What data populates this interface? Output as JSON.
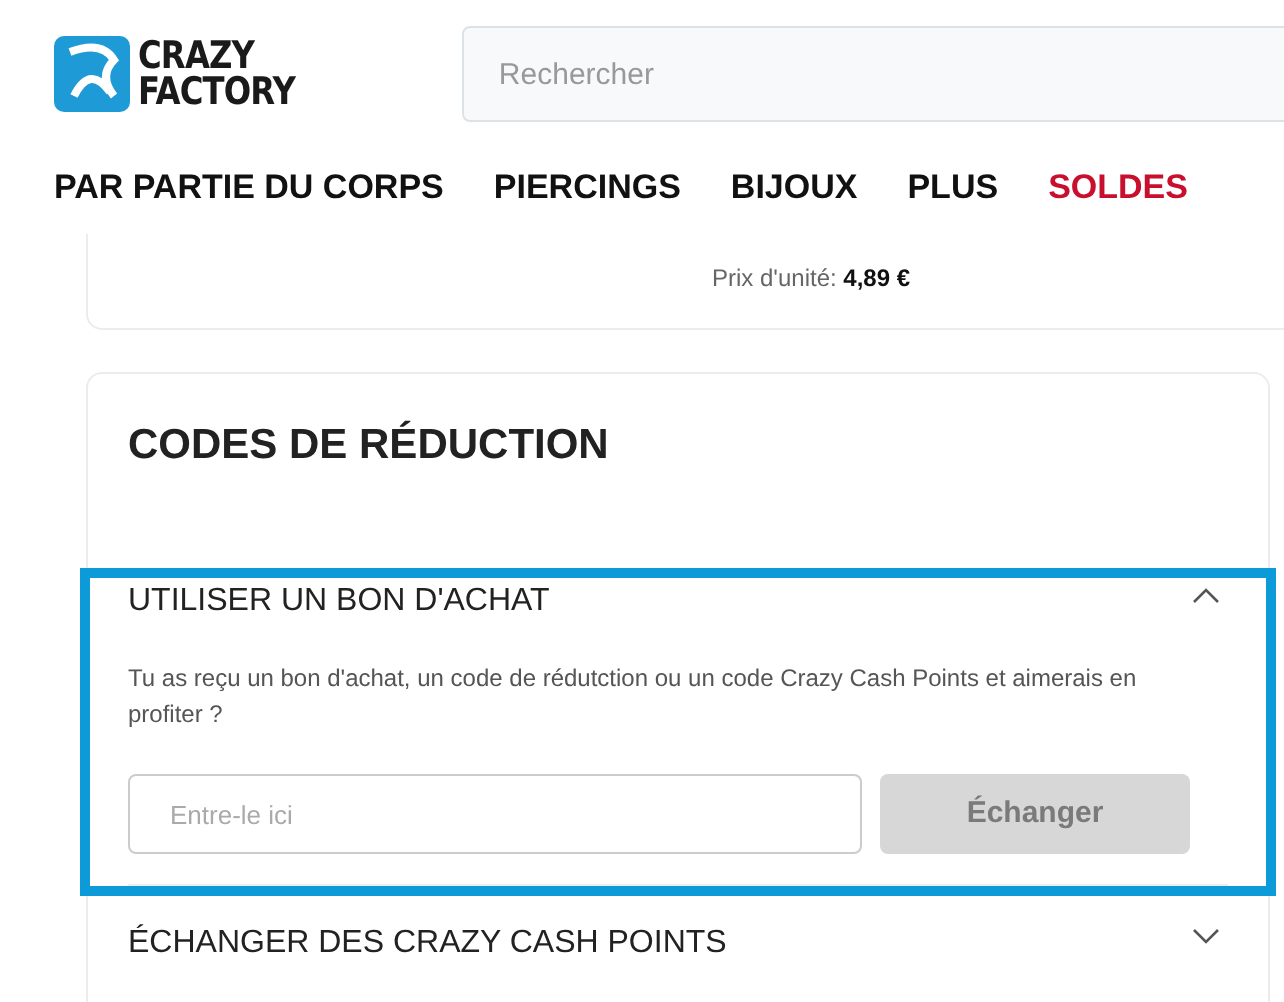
{
  "logo": {
    "line_1": "CRAZY",
    "line_2": "FACTORY"
  },
  "search": {
    "placeholder": "Rechercher"
  },
  "nav": [
    {
      "label": "PAR PARTIE DU CORPS",
      "sale": false
    },
    {
      "label": "PIERCINGS",
      "sale": false
    },
    {
      "label": "BIJOUX",
      "sale": false
    },
    {
      "label": "PLUS",
      "sale": false
    },
    {
      "label": "SOLDES",
      "sale": true
    }
  ],
  "price": {
    "label": "Prix d'unité:",
    "value": "4,89 €"
  },
  "discount": {
    "title": "CODES DE RÉDUCTION",
    "sections": [
      {
        "title": "UTILISER UN BON D'ACHAT",
        "expanded": true,
        "highlighted": true,
        "text": "Tu as reçu un bon d'achat, un code de rédutction ou un code Crazy Cash Points et aimerais en profiter ?",
        "placeholder": "Entre-le ici",
        "button": {
          "label": "Échanger",
          "disabled": true
        }
      },
      {
        "title": "ÉCHANGER DES CRAZY CASH POINTS",
        "expanded": false,
        "highlighted": false
      }
    ]
  }
}
